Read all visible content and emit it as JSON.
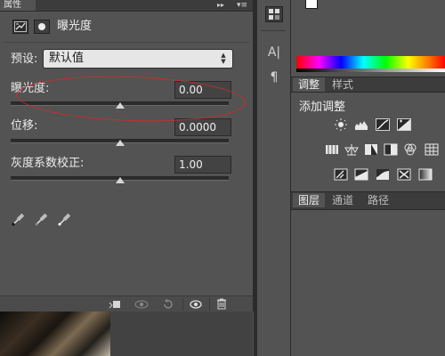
{
  "properties_panel": {
    "tab_label": "属性",
    "collapse_glyph": "▸▸",
    "menu_glyph": "▾≡",
    "title": "曝光度",
    "preset": {
      "label": "预设:",
      "value": "默认值"
    },
    "fields": {
      "exposure": {
        "label": "曝光度:",
        "value": "0.00",
        "slider_fraction": 0.5
      },
      "offset": {
        "label": "位移:",
        "value": "0.0000",
        "slider_fraction": 0.5
      },
      "gamma": {
        "label": "灰度系数校正:",
        "value": "1.00",
        "slider_fraction": 0.5
      }
    },
    "annotation_color": "#c4302b"
  },
  "right_panels": {
    "adjustments_tab": "调整",
    "styles_tab": "样式",
    "add_adjustment_label": "添加调整",
    "layers_tab": "图层",
    "channels_tab": "通道",
    "paths_tab": "路径"
  },
  "icons": {
    "toolbar": [
      "adjustments-icon",
      "character-icon",
      "paragraph-icon"
    ],
    "char_glyph": "A|",
    "para_glyph": "¶",
    "bottom": [
      "clip-to-layer-icon",
      "view-previous-state-icon",
      "reset-icon",
      "visibility-eye-icon",
      "trash-icon"
    ],
    "adjustment_rows": [
      [
        "brightness-contrast-icon",
        "levels-icon",
        "curves-icon",
        "exposure-icon"
      ],
      [
        "vibrance-icon",
        "hue-saturation-icon",
        "color-balance-icon",
        "black-white-icon",
        "photo-filter-icon",
        "channel-mixer-icon"
      ],
      [
        "invert-icon",
        "posterize-icon",
        "threshold-icon",
        "selective-color-icon",
        "gradient-map-icon"
      ]
    ]
  }
}
